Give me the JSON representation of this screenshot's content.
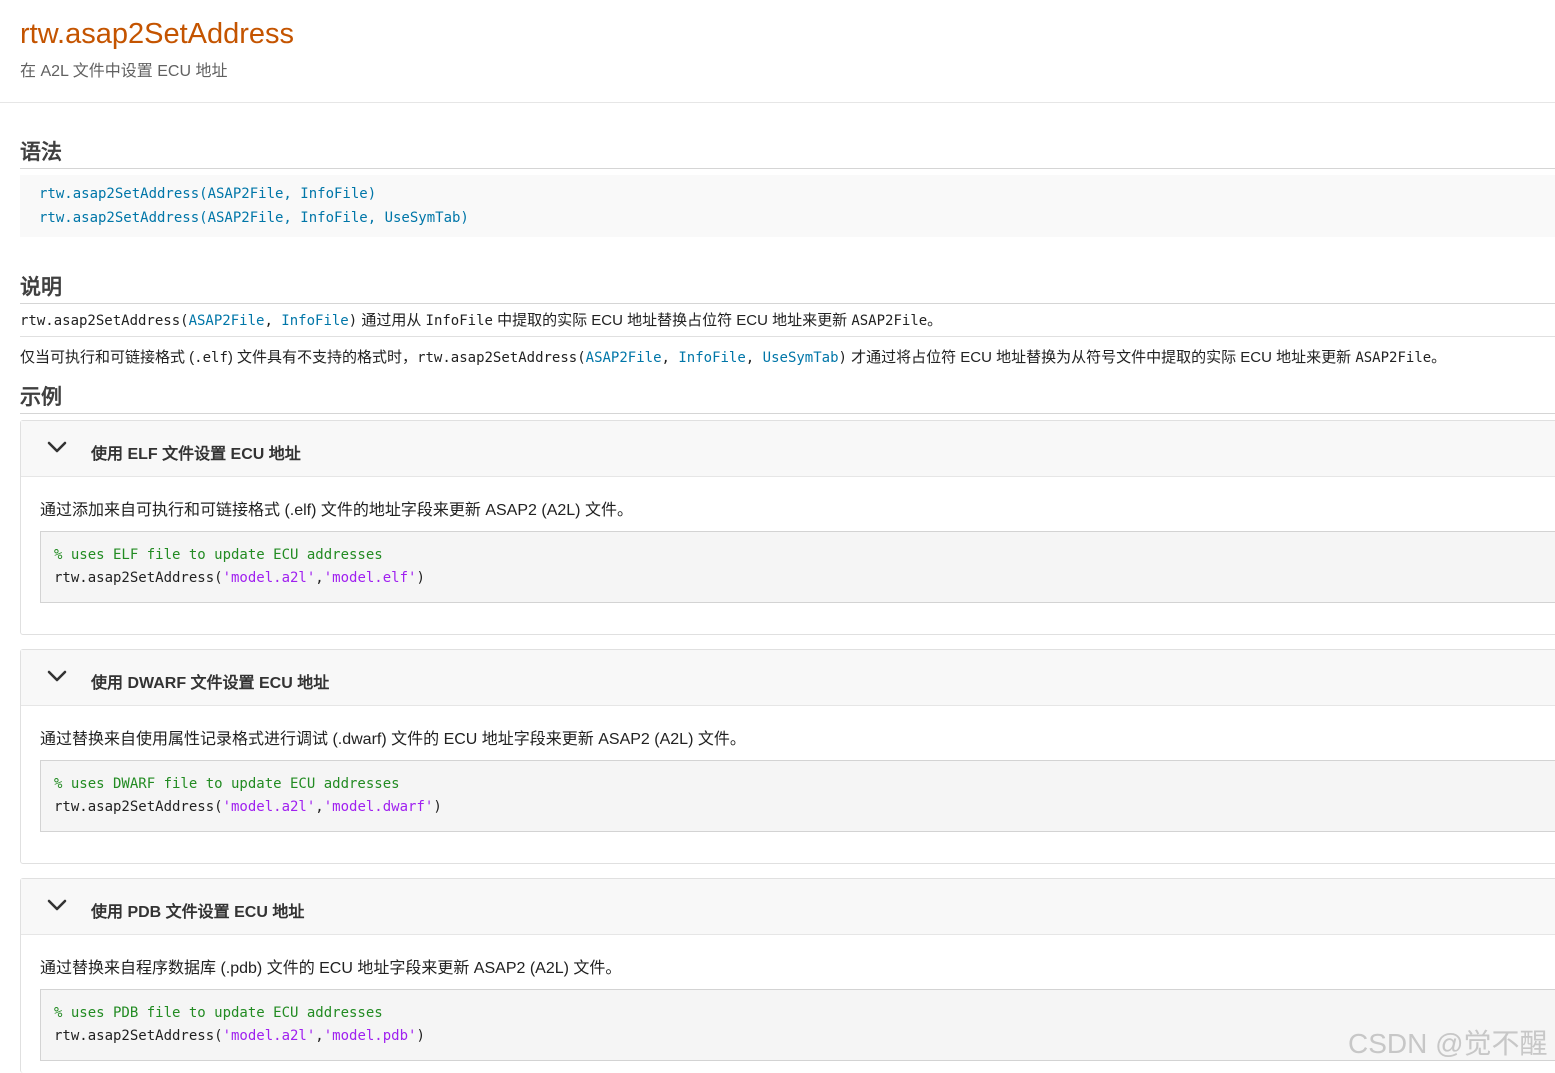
{
  "header": {
    "title": "rtw.asap2SetAddress",
    "subtitle": "在 A2L 文件中设置 ECU 地址"
  },
  "syntax": {
    "heading": "语法",
    "lines": [
      "rtw.asap2SetAddress(ASAP2File, InfoFile)",
      "rtw.asap2SetAddress(ASAP2File, InfoFile, UseSymTab)"
    ]
  },
  "description": {
    "heading": "说明",
    "p1": {
      "fn_open": "rtw.asap2SetAddress(",
      "arg1": "ASAP2File",
      "sep1": ", ",
      "arg2": "InfoFile",
      "close": ")",
      "text1": " 通过用从 ",
      "infofile": "InfoFile",
      "text2": " 中提取的实际 ECU 地址替换占位符 ECU 地址来更新 ",
      "asap2file": "ASAP2File",
      "end": "。"
    },
    "p2": {
      "text1": "仅当可执行和可链接格式 (",
      "elf": ".elf",
      "text2": ") 文件具有不支持的格式时，",
      "fn_open": "rtw.asap2SetAddress(",
      "arg1": "ASAP2File",
      "sep1": ", ",
      "arg2": "InfoFile",
      "sep2": ", ",
      "arg3": "UseSymTab",
      "close": ")",
      "text3": " 才通过将占位符 ECU 地址替换为从符号文件中提取的实际 ECU 地址来更新 ",
      "asap2file": "ASAP2File",
      "end": "。"
    }
  },
  "examples": {
    "heading": "示例",
    "items": [
      {
        "title": "使用 ELF 文件设置 ECU 地址",
        "description": "通过添加来自可执行和可链接格式 (.elf) 文件的地址字段来更新 ASAP2 (A2L) 文件。",
        "comment": "% uses ELF file to update ECU addresses",
        "call_prefix": "rtw.asap2SetAddress(",
        "arg1": "'model.a2l'",
        "comma": ",",
        "arg2": "'model.elf'",
        "call_suffix": ")"
      },
      {
        "title": "使用 DWARF 文件设置 ECU 地址",
        "description": "通过替换来自使用属性记录格式进行调试 (.dwarf) 文件的 ECU 地址字段来更新 ASAP2 (A2L) 文件。",
        "comment": "% uses DWARF file to update ECU addresses",
        "call_prefix": "rtw.asap2SetAddress(",
        "arg1": "'model.a2l'",
        "comma": ",",
        "arg2": "'model.dwarf'",
        "call_suffix": ")"
      },
      {
        "title": "使用 PDB 文件设置 ECU 地址",
        "description": "通过替换来自程序数据库 (.pdb) 文件的 ECU 地址字段来更新 ASAP2 (A2L) 文件。",
        "comment": "% uses PDB file to update ECU addresses",
        "call_prefix": "rtw.asap2SetAddress(",
        "arg1": "'model.a2l'",
        "comma": ",",
        "arg2": "'model.pdb'",
        "call_suffix": ")"
      }
    ]
  },
  "watermark": "CSDN @觉不醒",
  "colors": {
    "title": "#c45400",
    "link": "#0076a8",
    "comment": "#228b22",
    "string": "#a020f0"
  },
  "icons": {
    "expand": "chevron-down-icon"
  }
}
